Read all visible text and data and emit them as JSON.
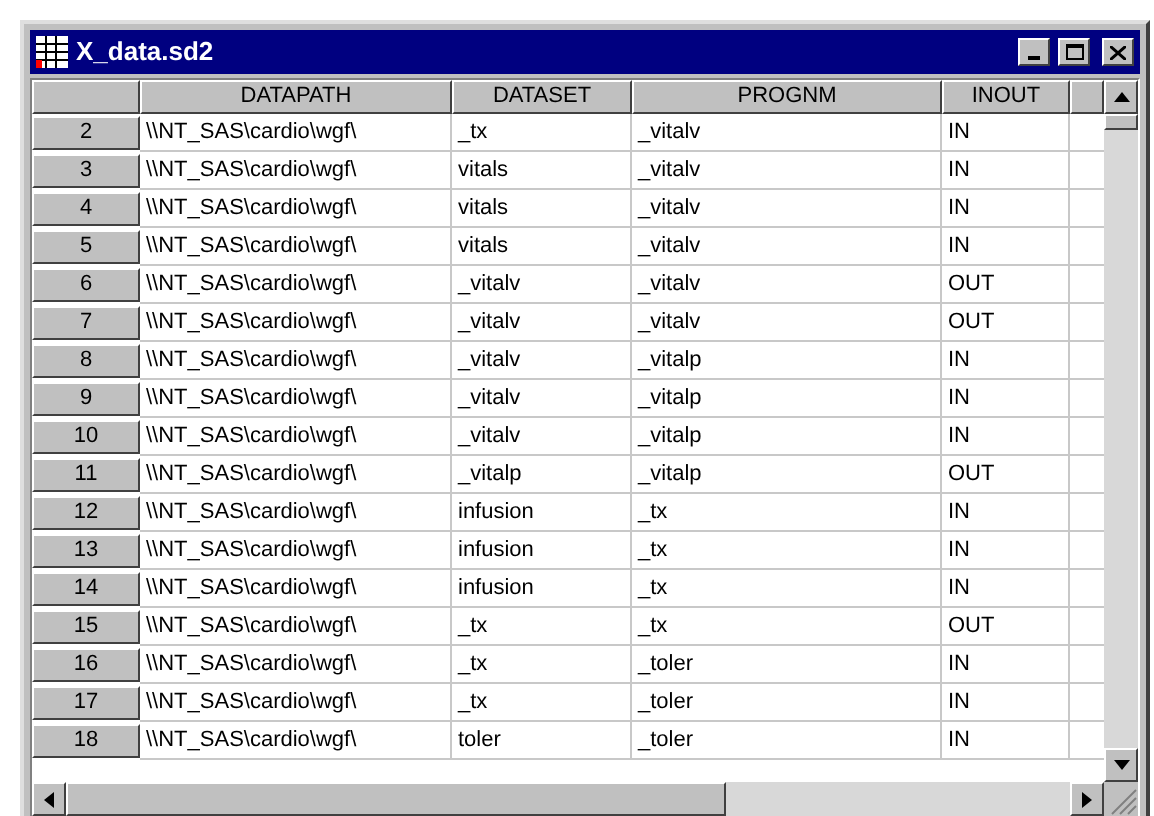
{
  "window": {
    "title": "X_data.sd2"
  },
  "table": {
    "columns": [
      "DATAPATH",
      "DATASET",
      "PROGNM",
      "INOUT"
    ],
    "rows": [
      {
        "number": "2",
        "cells": [
          "\\\\NT_SAS\\cardio\\wgf\\",
          "_tx",
          "_vitalv",
          "IN"
        ]
      },
      {
        "number": "3",
        "cells": [
          "\\\\NT_SAS\\cardio\\wgf\\",
          "vitals",
          "_vitalv",
          "IN"
        ]
      },
      {
        "number": "4",
        "cells": [
          "\\\\NT_SAS\\cardio\\wgf\\",
          "vitals",
          "_vitalv",
          "IN"
        ]
      },
      {
        "number": "5",
        "cells": [
          "\\\\NT_SAS\\cardio\\wgf\\",
          "vitals",
          "_vitalv",
          "IN"
        ]
      },
      {
        "number": "6",
        "cells": [
          "\\\\NT_SAS\\cardio\\wgf\\",
          "_vitalv",
          "_vitalv",
          "OUT"
        ]
      },
      {
        "number": "7",
        "cells": [
          "\\\\NT_SAS\\cardio\\wgf\\",
          "_vitalv",
          "_vitalv",
          "OUT"
        ]
      },
      {
        "number": "8",
        "cells": [
          "\\\\NT_SAS\\cardio\\wgf\\",
          "_vitalv",
          "_vitalp",
          "IN"
        ]
      },
      {
        "number": "9",
        "cells": [
          "\\\\NT_SAS\\cardio\\wgf\\",
          "_vitalv",
          "_vitalp",
          "IN"
        ]
      },
      {
        "number": "10",
        "cells": [
          "\\\\NT_SAS\\cardio\\wgf\\",
          "_vitalv",
          "_vitalp",
          "IN"
        ]
      },
      {
        "number": "11",
        "cells": [
          "\\\\NT_SAS\\cardio\\wgf\\",
          "_vitalp",
          "_vitalp",
          "OUT"
        ]
      },
      {
        "number": "12",
        "cells": [
          "\\\\NT_SAS\\cardio\\wgf\\",
          "infusion",
          "_tx",
          "IN"
        ]
      },
      {
        "number": "13",
        "cells": [
          "\\\\NT_SAS\\cardio\\wgf\\",
          "infusion",
          "_tx",
          "IN"
        ]
      },
      {
        "number": "14",
        "cells": [
          "\\\\NT_SAS\\cardio\\wgf\\",
          "infusion",
          "_tx",
          "IN"
        ]
      },
      {
        "number": "15",
        "cells": [
          "\\\\NT_SAS\\cardio\\wgf\\",
          "_tx",
          "_tx",
          "OUT"
        ]
      },
      {
        "number": "16",
        "cells": [
          "\\\\NT_SAS\\cardio\\wgf\\",
          "_tx",
          "_toler",
          "IN"
        ]
      },
      {
        "number": "17",
        "cells": [
          "\\\\NT_SAS\\cardio\\wgf\\",
          "_tx",
          "_toler",
          "IN"
        ]
      },
      {
        "number": "18",
        "cells": [
          "\\\\NT_SAS\\cardio\\wgf\\",
          "toler",
          "_toler",
          "IN"
        ]
      }
    ]
  }
}
